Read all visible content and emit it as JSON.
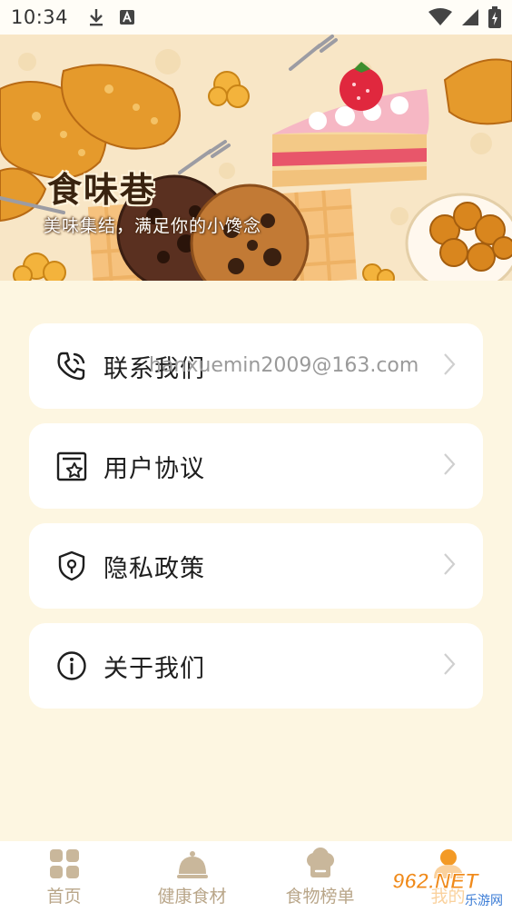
{
  "status_bar": {
    "time": "10:34",
    "icons": [
      "download-icon",
      "keyboard-a-icon",
      "wifi-icon",
      "signal-icon",
      "battery-icon"
    ]
  },
  "banner": {
    "title": "食味巷",
    "subtitle": "美味集结，满足你的小馋念"
  },
  "menu": [
    {
      "label": "联系我们",
      "extra": "hanxuemin2009@163.com",
      "icon": "phone-icon"
    },
    {
      "label": "用户协议",
      "icon": "agreement-star-icon"
    },
    {
      "label": "隐私政策",
      "icon": "shield-icon"
    },
    {
      "label": "关于我们",
      "icon": "info-icon"
    }
  ],
  "bottom_nav": {
    "items": [
      {
        "label": "首页",
        "icon": "home-grid-icon"
      },
      {
        "label": "健康食材",
        "icon": "cloche-icon"
      },
      {
        "label": "食物榜单",
        "icon": "chef-hat-icon"
      },
      {
        "label": "我的",
        "icon": "profile-icon",
        "active": true
      }
    ]
  },
  "watermark": {
    "main": "962.NET",
    "sub": "乐游网"
  },
  "colors": {
    "background": "#FDF6E1",
    "card": "#FFFFFF",
    "nav_inactive": "#B9A689",
    "nav_active": "#F39A26"
  }
}
